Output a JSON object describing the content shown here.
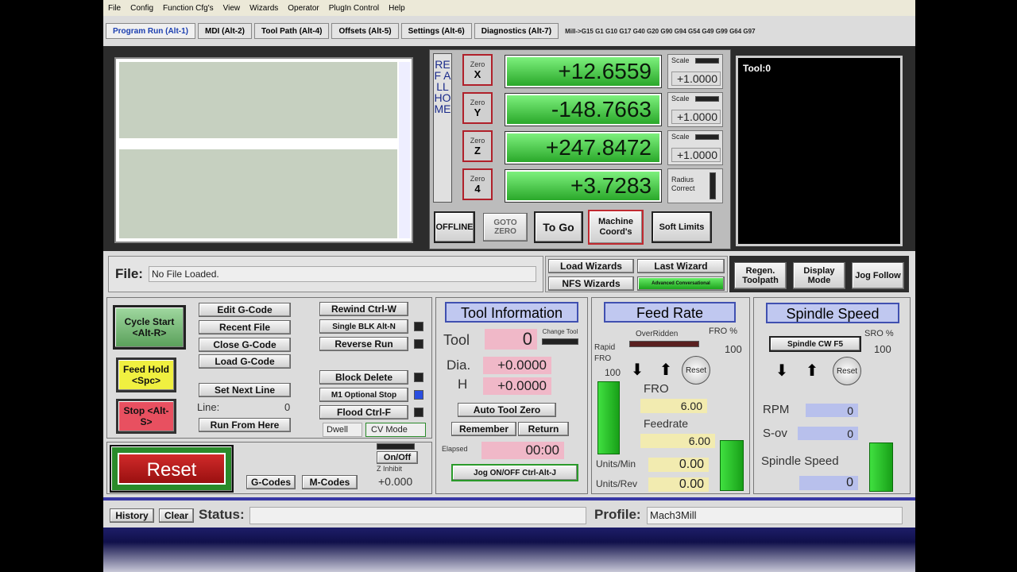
{
  "menu": [
    "File",
    "Config",
    "Function Cfg's",
    "View",
    "Wizards",
    "Operator",
    "PlugIn Control",
    "Help"
  ],
  "tabs": [
    "Program Run (Alt-1)",
    "MDI (Alt-2)",
    "Tool Path (Alt-4)",
    "Offsets (Alt-5)",
    "Settings (Alt-6)",
    "Diagnostics (Alt-7)"
  ],
  "gcode_status": "Mill->G15  G1 G10 G17 G40 G20 G90 G94 G54 G49 G99 G64 G97",
  "ref_all_home": "REF ALL HOME",
  "axes": [
    {
      "zero_label": "Zero",
      "axis": "X",
      "dro": "+12.6559",
      "scale_label": "Scale",
      "scale": "+1.0000"
    },
    {
      "zero_label": "Zero",
      "axis": "Y",
      "dro": "-148.7663",
      "scale_label": "Scale",
      "scale": "+1.0000"
    },
    {
      "zero_label": "Zero",
      "axis": "Z",
      "dro": "+247.8472",
      "scale_label": "Scale",
      "scale": "+1.0000"
    },
    {
      "zero_label": "Zero",
      "axis": "4",
      "dro": "+3.7283",
      "scale_label": "Radius Correct",
      "scale": ""
    }
  ],
  "dro_buttons": {
    "offline": "OFFLINE",
    "gotoz": "GOTO ZERO",
    "togo": "To Go",
    "machine": "Machine Coord's",
    "soft": "Soft Limits"
  },
  "tool_display": "Tool:0",
  "file": {
    "label": "File:",
    "value": "No File Loaded."
  },
  "wizards": {
    "load": "Load Wizards",
    "last": "Last Wizard",
    "nfs": "NFS Wizards",
    "bar": "Advanced Conversational"
  },
  "view_buttons": {
    "regen": "Regen. Toolpath",
    "display": "Display Mode",
    "jog": "Jog Follow"
  },
  "program": {
    "cycle_start": "Cycle Start <Alt-R>",
    "feed_hold": "Feed Hold <Spc>",
    "stop": "Stop <Alt-S>",
    "edit": "Edit G-Code",
    "recent": "Recent File",
    "close": "Close G-Code",
    "load": "Load G-Code",
    "set_next": "Set Next Line",
    "line_label": "Line:",
    "line_value": "0",
    "run_from": "Run From Here",
    "rewind": "Rewind Ctrl-W",
    "single": "Single BLK Alt-N",
    "reverse": "Reverse Run",
    "block_delete": "Block Delete",
    "m1": "M1 Optional Stop",
    "flood": "Flood Ctrl-F",
    "dwell": "Dwell",
    "cv": "CV Mode",
    "reset": "Reset",
    "gcodes": "G-Codes",
    "mcodes": "M-Codes",
    "onoff": "On/Off",
    "zinhibit": "Z Inhibit",
    "zinhibit_val": "+0.000"
  },
  "tool_info": {
    "title": "Tool Information",
    "tool_label": "Tool",
    "tool_value": "0",
    "change": "Change Tool",
    "dia_label": "Dia.",
    "dia_value": "+0.0000",
    "h_label": "H",
    "h_value": "+0.0000",
    "auto_zero": "Auto Tool Zero",
    "remember": "Remember",
    "return": "Return",
    "elapsed_label": "Elapsed",
    "elapsed": "00:00",
    "jog": "Jog ON/OFF Ctrl-Alt-J"
  },
  "feed": {
    "title": "Feed Rate",
    "overridden": "OverRidden",
    "fro_pct_label": "FRO %",
    "fro_pct": "100",
    "rapid_label": "Rapid FRO",
    "rapid_value": "100",
    "reset": "Reset",
    "fro_label": "FRO",
    "fro_value": "6.00",
    "feedrate_label": "Feedrate",
    "feedrate_value": "6.00",
    "upm_label": "Units/Min",
    "upm_value": "0.00",
    "upr_label": "Units/Rev",
    "upr_value": "0.00"
  },
  "spindle": {
    "title": "Spindle Speed",
    "sro_label": "SRO %",
    "sro_value": "100",
    "cw": "Spindle CW F5",
    "reset": "Reset",
    "rpm_label": "RPM",
    "rpm_value": "0",
    "sov_label": "S-ov",
    "sov_value": "0",
    "speed_label": "Spindle Speed",
    "speed_value": "0"
  },
  "status": {
    "history": "History",
    "clear": "Clear",
    "label": "Status:",
    "profile_label": "Profile:",
    "profile": "Mach3Mill"
  }
}
